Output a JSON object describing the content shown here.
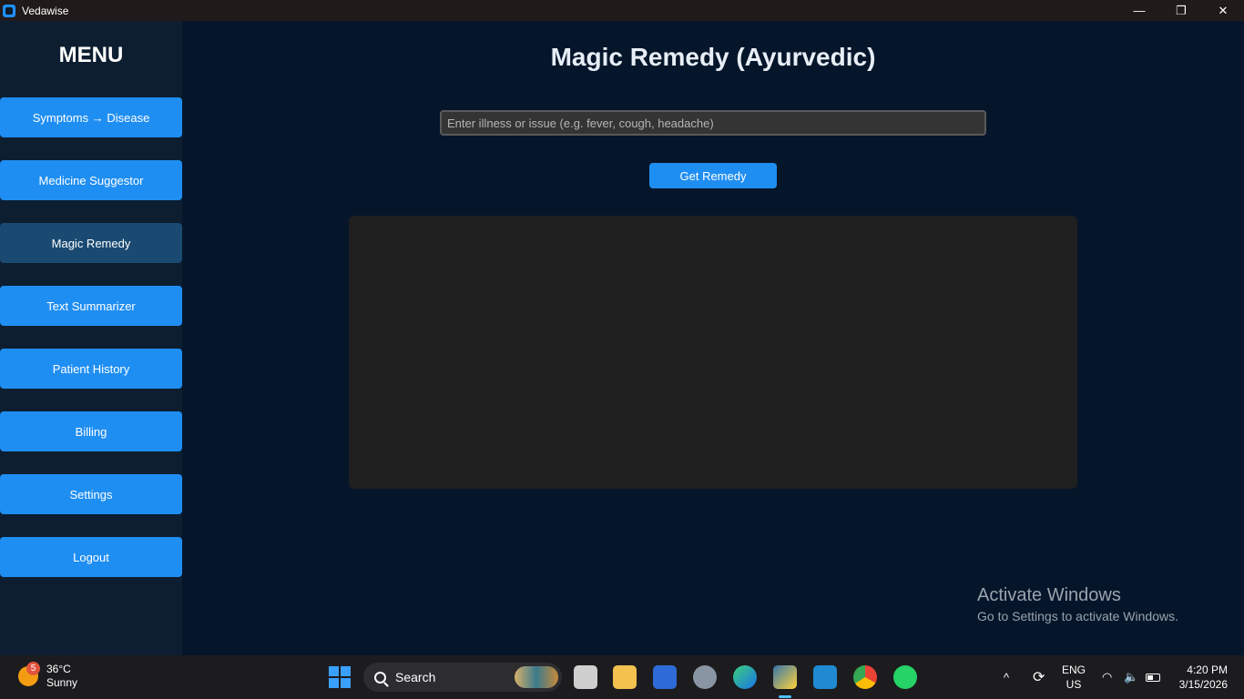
{
  "window": {
    "title": "Vedawise",
    "minimize_glyph": "—",
    "maximize_glyph": "❐",
    "close_glyph": "✕"
  },
  "sidebar": {
    "title": "MENU",
    "items": [
      {
        "label": "Symptoms → Disease",
        "active": false
      },
      {
        "label": "Medicine Suggestor",
        "active": false
      },
      {
        "label": "Magic Remedy",
        "active": true
      },
      {
        "label": "Text Summarizer",
        "active": false
      },
      {
        "label": "Patient History",
        "active": false
      },
      {
        "label": "Billing",
        "active": false
      },
      {
        "label": "Settings",
        "active": false
      },
      {
        "label": "Logout",
        "active": false
      }
    ]
  },
  "main": {
    "title": "Magic Remedy (Ayurvedic)",
    "input_placeholder": "Enter illness or issue (e.g. fever, cough, headache)",
    "input_value": "",
    "button_label": "Get Remedy",
    "result_text": ""
  },
  "watermark": {
    "line1": "Activate Windows",
    "line2": "Go to Settings to activate Windows."
  },
  "taskbar": {
    "weather_badge": "5",
    "weather_temp": "36°C",
    "weather_desc": "Sunny",
    "search_label": "Search",
    "lang_line1": "ENG",
    "lang_line2": "US",
    "time": "4:20 PM",
    "date": "3/15/2026",
    "chevron_glyph": "^",
    "sync_glyph": "⟳",
    "wifi_glyph": "◠",
    "volume_glyph": "🔈"
  },
  "colors": {
    "accent": "#1f8ef2",
    "active_item": "#1a4a72",
    "background": "#06162a",
    "sidebar": "#0c1e30",
    "result_box": "#1f1f1f"
  }
}
